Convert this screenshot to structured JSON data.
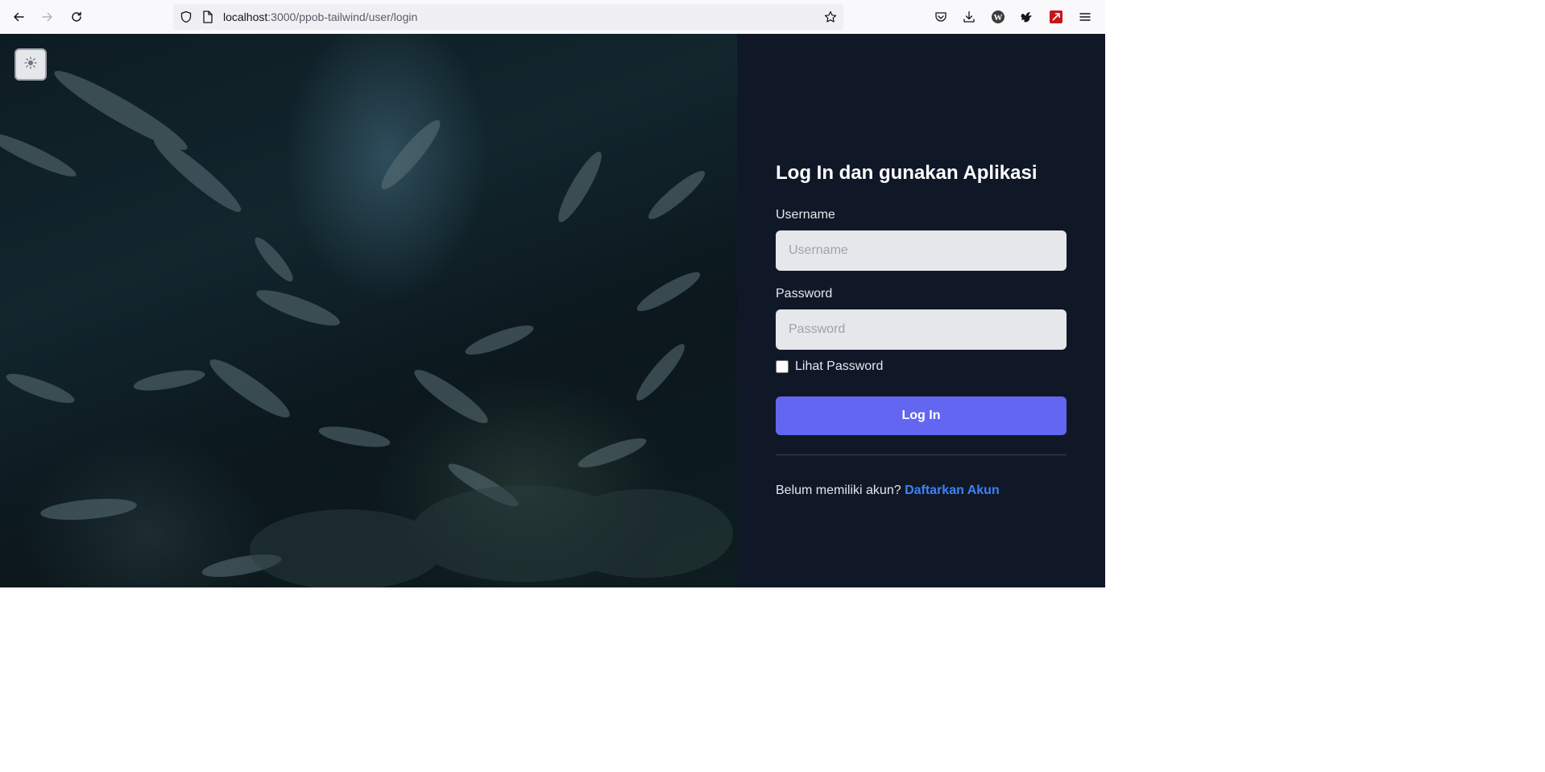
{
  "browser": {
    "url_host": "localhost",
    "url_path": ":3000/ppob-tailwind/user/login",
    "icons": {
      "back": "back-arrow-icon",
      "forward": "forward-arrow-icon",
      "reload": "reload-icon",
      "shield": "shield-icon",
      "page": "page-icon",
      "bookmark": "star-icon",
      "pocket": "pocket-icon",
      "downloads": "download-icon",
      "wordpress": "wordpress-icon",
      "extension": "extension-icon",
      "pdf": "pdf-icon",
      "menu": "hamburger-menu-icon"
    }
  },
  "hero": {
    "theme_toggle_icon": "sun-icon"
  },
  "login": {
    "title": "Log In dan gunakan Aplikasi",
    "username_label": "Username",
    "username_placeholder": "Username",
    "password_label": "Password",
    "password_placeholder": "Password",
    "show_password_label": "Lihat Password",
    "submit_label": "Log In",
    "register_prompt": "Belum memiliki akun?",
    "register_link": "Daftarkan Akun"
  },
  "colors": {
    "panel_bg": "#101828",
    "button_bg": "#6366f1",
    "link": "#3b82f6",
    "input_bg": "#e5e7eb"
  }
}
